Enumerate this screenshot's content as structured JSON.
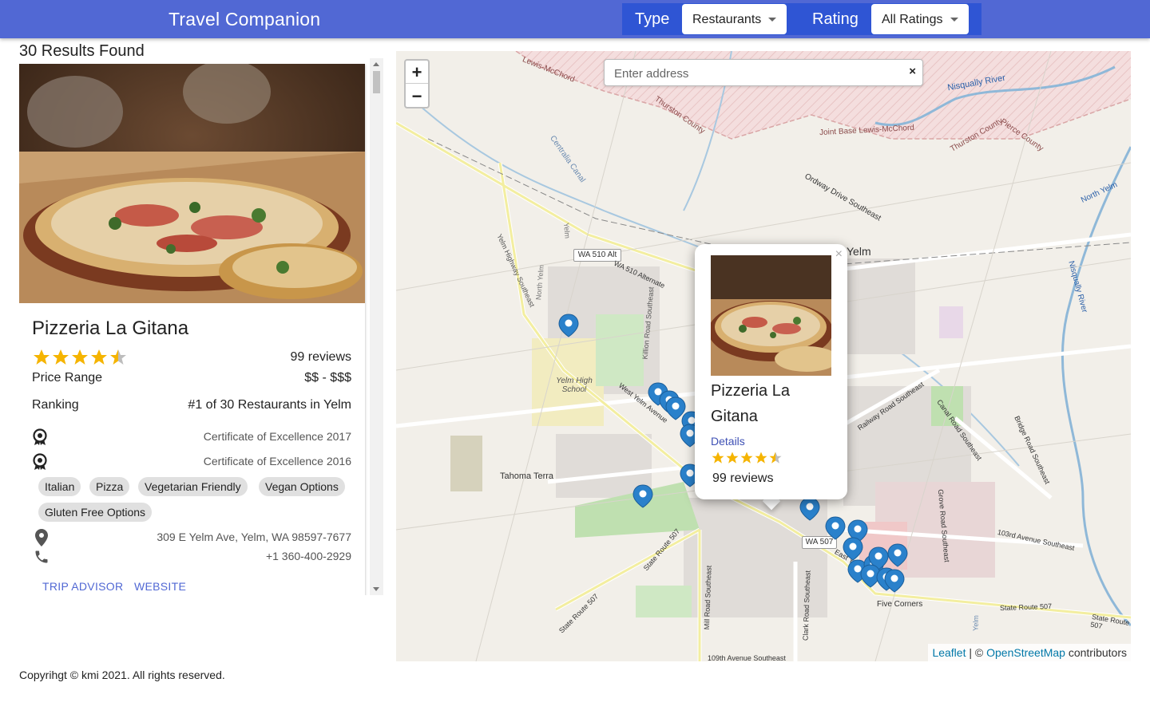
{
  "header": {
    "title": "Travel Companion",
    "type_label": "Type",
    "type_value": "Restaurants",
    "rating_label": "Rating",
    "rating_value": "All Ratings"
  },
  "results": {
    "count_text": "30 Results Found"
  },
  "card": {
    "name": "Pizzeria La Gitana",
    "rating": 4.5,
    "reviews": "99 reviews",
    "price_label": "Price Range",
    "price_value": "$$ - $$$",
    "ranking_label": "Ranking",
    "ranking_value": "#1 of 30 Restaurants in Yelm",
    "awards": [
      "Certificate of Excellence 2017",
      "Certificate of Excellence 2016"
    ],
    "cuisines": [
      "Italian",
      "Pizza",
      "Vegetarian Friendly",
      "Vegan Options",
      "Gluten Free Options"
    ],
    "address": "309 E Yelm Ave, Yelm, WA 98597-7677",
    "phone": "+1 360-400-2929",
    "trip_advisor_label": "TRIP ADVISOR",
    "website_label": "WEBSITE"
  },
  "map": {
    "search_placeholder": "Enter address",
    "zoom_in": "+",
    "zoom_out": "−",
    "clear": "×",
    "labels": {
      "lewis_mcchord": "Lewis-McChord",
      "thurston": "Thurston County",
      "nisqually": "Nisqually River",
      "pierce": "Pierce County",
      "joint_base": "Joint Base Lewis-McChord",
      "thurston2": "Thurston County",
      "centralia": "Centralia Canal",
      "ordway": "Ordway Drive Southeast",
      "north_yelm": "North Yelm",
      "wa510alt": "WA 510 Alt",
      "wa510alternate": "WA 510 Alternate",
      "yelm_hwy": "Yelm Highway Southeast",
      "north_yelm2": "North Yelm",
      "killion": "Killion Road Southeast",
      "yelm_hs": "Yelm High School",
      "west_yelm": "West Yelm Avenue",
      "tahoma": "Tahoma Terra",
      "yelm": "Yelm",
      "railway": "Railway Road Southeast",
      "canal": "Canal Road Southeast",
      "bridge": "Bridge Road Southeast",
      "grove": "Grove Road Southeast",
      "ave103": "103rd Avenue Southeast",
      "wa507": "WA 507",
      "sr507": "State Route 507",
      "sr507b": "State Route 507",
      "sr507c": "State Route 507",
      "sr507d": "State Route 507",
      "mill": "Mill Road Southeast",
      "clark": "Clark Road Southeast",
      "five_corners": "Five Corners",
      "ave109": "109th Avenue Southeast",
      "nisqually2": "Nisqually River",
      "east_yelm": "East Yelm Avenue",
      "yelm_small": "Yelm",
      "yelm_n": "Yelm"
    },
    "popup": {
      "close": "×",
      "name": "Pizzeria La Gitana",
      "details": "Details",
      "rating": 4.5,
      "reviews": "99 reviews"
    },
    "attribution": {
      "leaflet": "Leaflet",
      "sep": " | © ",
      "osm": "OpenStreetMap",
      "contributors": " contributors"
    }
  },
  "footer": {
    "text": "Copyrihgt © kmi 2021. All rights reserved."
  },
  "colors": {
    "header": "#5168d4",
    "filter_bg": "#2f55d4",
    "star": "#f5b400",
    "marker": "#2a81cb",
    "link": "#5168d4"
  }
}
